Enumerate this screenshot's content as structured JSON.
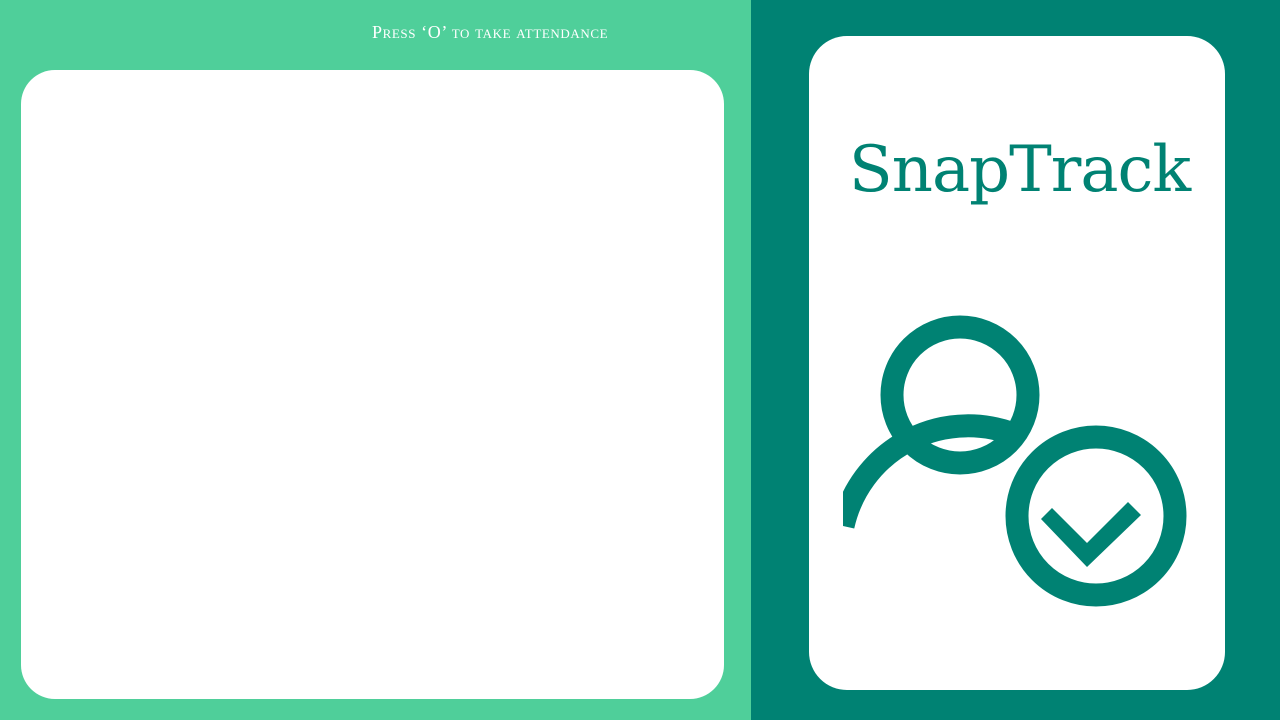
{
  "left_panel": {
    "instruction": "Press ‘O’ to take attendance"
  },
  "right_panel": {
    "brand_name": "SnapTrack",
    "logo_icon": "user-check-icon"
  },
  "colors": {
    "light_green": "#4fcf9a",
    "teal": "#008273",
    "card": "#ffffff"
  }
}
